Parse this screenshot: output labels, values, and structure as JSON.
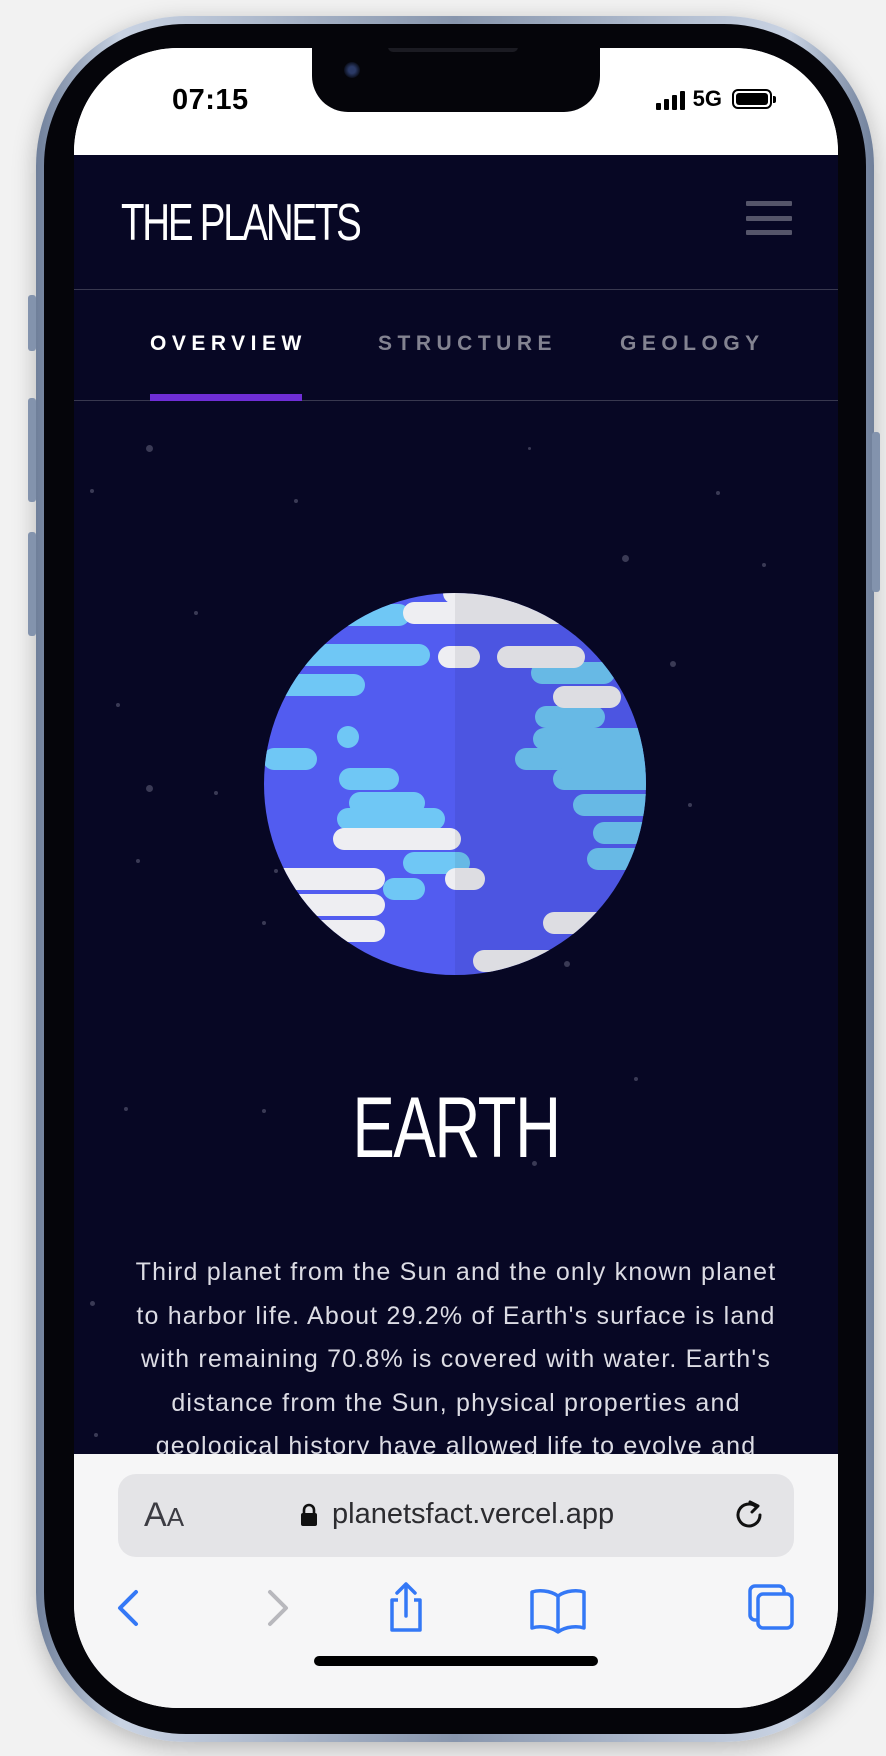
{
  "status_bar": {
    "time": "07:15",
    "network": "5G"
  },
  "app": {
    "logo": "THE PLANETS",
    "menu_icon": "hamburger-menu-icon",
    "tabs": [
      {
        "label": "OVERVIEW",
        "active": true
      },
      {
        "label": "STRUCTURE",
        "active": false
      },
      {
        "label": "GEOLOGY",
        "active": false
      }
    ],
    "accent_color": "#6f2ed6",
    "background_color": "#070724",
    "planet": {
      "name": "EARTH",
      "description": "Third planet from the Sun and the only known planet to harbor life. About 29.2% of Earth's surface is land with remaining 70.8% is covered with water. Earth's distance from the Sun, physical properties and geological history have allowed life to evolve and thrive."
    }
  },
  "browser": {
    "text_size_label": "AA",
    "url": "planetsfact.vercel.app",
    "toolbar": [
      "back-icon",
      "forward-icon",
      "share-icon",
      "bookmarks-icon",
      "tabs-icon"
    ]
  }
}
